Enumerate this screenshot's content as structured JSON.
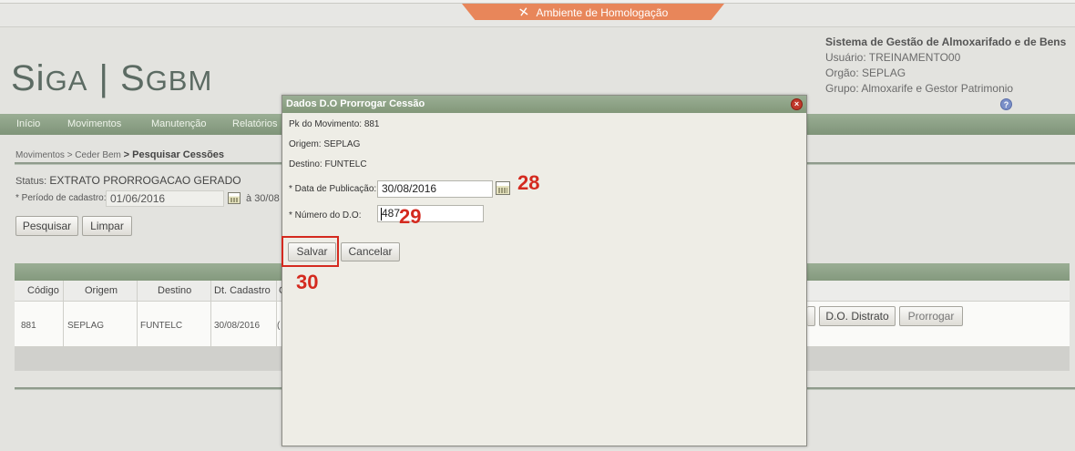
{
  "environment": {
    "label": "Ambiente de Homologação"
  },
  "logo": {
    "text1": "Si",
    "text1b": "GA",
    "sep": " | ",
    "text2": "S",
    "text2b": "GBM"
  },
  "system": {
    "name": "Sistema de Gestão de Almoxarifado e de Bens",
    "user": "Usuário: TREINAMENTO00",
    "org": "Orgão: SEPLAG",
    "group": "Grupo: Almoxarife e Gestor Patrimonio"
  },
  "menu": [
    "Início",
    "Movimentos",
    "Manutenção",
    "Relatórios"
  ],
  "breadcrumb": {
    "part1": "Movimentos",
    "part2": "> Ceder Bem",
    "part3": "> Pesquisar Cessões"
  },
  "filters": {
    "status_label": "Status:",
    "status_value": "EXTRATO PRORROGACAO GERADO",
    "period_label": "* Período de cadastro:",
    "period_from": "01/06/2016",
    "period_sep": "à",
    "period_to": "30/08"
  },
  "buttons": {
    "search": "Pesquisar",
    "clear": "Limpar",
    "distrato": "D.O. Distrato",
    "prorrogar": "Prorrogar"
  },
  "table": {
    "columns": [
      "Código",
      "Origem",
      "Destino",
      "Dt. Cadastro",
      "C"
    ],
    "rows": [
      {
        "codigo": "881",
        "origem": "SEPLAG",
        "destino": "FUNTELC",
        "dt_cadastro": "30/08/2016",
        "c": "("
      }
    ]
  },
  "modal": {
    "title": "Dados D.O Prorrogar Cessão",
    "pk": "Pk do Movimento: 881",
    "origem": "Origem: SEPLAG",
    "destino": "Destino: FUNTELC",
    "data_pub_label": "* Data de Publicação:",
    "data_pub_value": "30/08/2016",
    "numero_label": "* Número do D.O:",
    "numero_value": "487",
    "save": "Salvar",
    "cancel": "Cancelar"
  },
  "annotations": {
    "a28": "28",
    "a29": "29",
    "a30": "30"
  },
  "colors": {
    "accent_green": "#8ea387",
    "env_orange": "#e8865a",
    "annotation_red": "#d42a1f"
  }
}
